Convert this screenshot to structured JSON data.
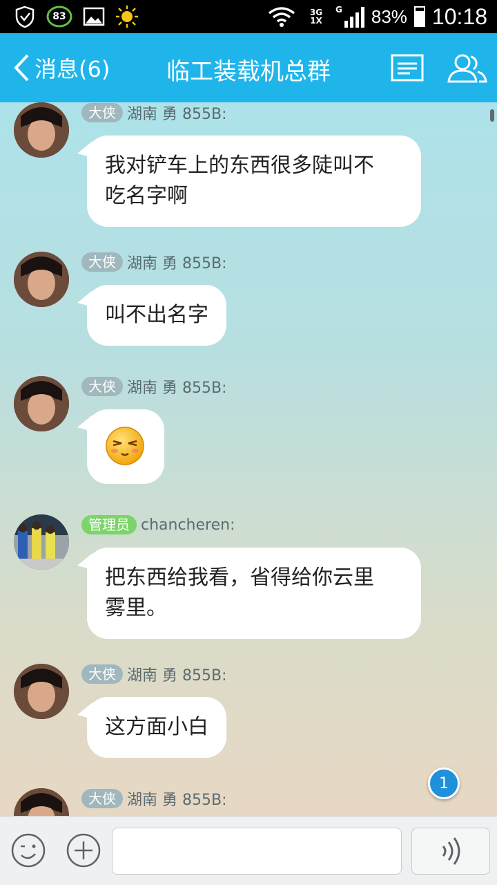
{
  "status_bar": {
    "badge_number": "83",
    "network_top": "3G",
    "network_bottom": "1X",
    "network_g": "G",
    "battery": "83%",
    "time": "10:18"
  },
  "header": {
    "back_label": "消息(6)",
    "title": "临工装载机总群",
    "accent": "#1fb5eb"
  },
  "messages": [
    {
      "badge": "大侠",
      "sender": "湖南 勇 855B:",
      "text_lines": [
        "我对铲车上的东西很多陡叫不",
        "吃名字啊"
      ]
    },
    {
      "badge": "大侠",
      "sender": "湖南 勇 855B:",
      "text_lines": [
        "叫不出名字"
      ]
    },
    {
      "badge": "大侠",
      "sender": "湖南 勇 855B:",
      "emoji": "smirk-face-emoji"
    },
    {
      "badge": "管理员",
      "sender": "chancheren:",
      "text_lines": [
        "把东西给我看，省得给你云里",
        "雾里。"
      ]
    },
    {
      "badge": "大侠",
      "sender": "湖南 勇 855B:",
      "text_lines": [
        "这方面小白"
      ]
    },
    {
      "badge": "大侠",
      "sender": "湖南 勇 855B:"
    }
  ],
  "new_message_count": "1",
  "input_bar": {
    "emoji_icon": "emoji-icon",
    "plus_icon": "plus-icon",
    "voice_icon": "voice-icon"
  }
}
